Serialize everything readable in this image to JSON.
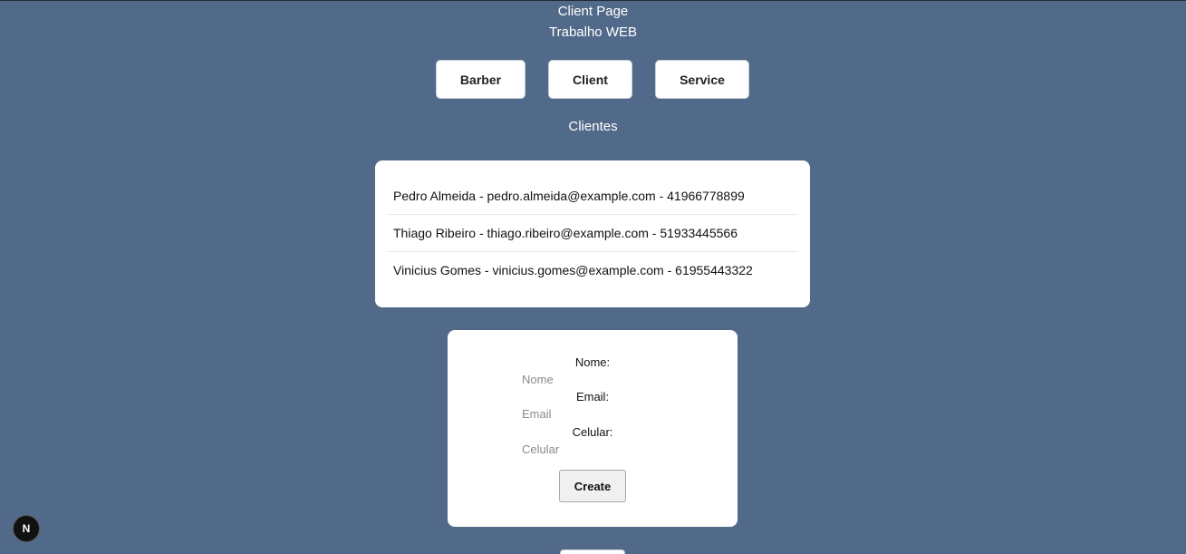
{
  "header": {
    "title": "Client Page",
    "subtitle": "Trabalho WEB"
  },
  "nav": {
    "barber_label": "Barber",
    "client_label": "Client",
    "service_label": "Service"
  },
  "clients_section": {
    "title": "Clientes",
    "items": [
      "Pedro Almeida - pedro.almeida@example.com - 41966778899",
      "Thiago Ribeiro - thiago.ribeiro@example.com - 51933445566",
      "Vinicius Gomes - vinicius.gomes@example.com - 61955443322"
    ]
  },
  "form": {
    "name_label": "Nome:",
    "name_placeholder": "Nome",
    "name_value": "",
    "email_label": "Email:",
    "email_placeholder": "Email",
    "email_value": "",
    "phone_label": "Celular:",
    "phone_placeholder": "Celular",
    "phone_value": "",
    "create_label": "Create"
  },
  "dev_badge": {
    "letter": "N",
    "icon": "nextjs-icon"
  },
  "colors": {
    "background": "#526a89",
    "card": "#ffffff",
    "text_light": "#ffffff",
    "text_dark": "#111111"
  }
}
